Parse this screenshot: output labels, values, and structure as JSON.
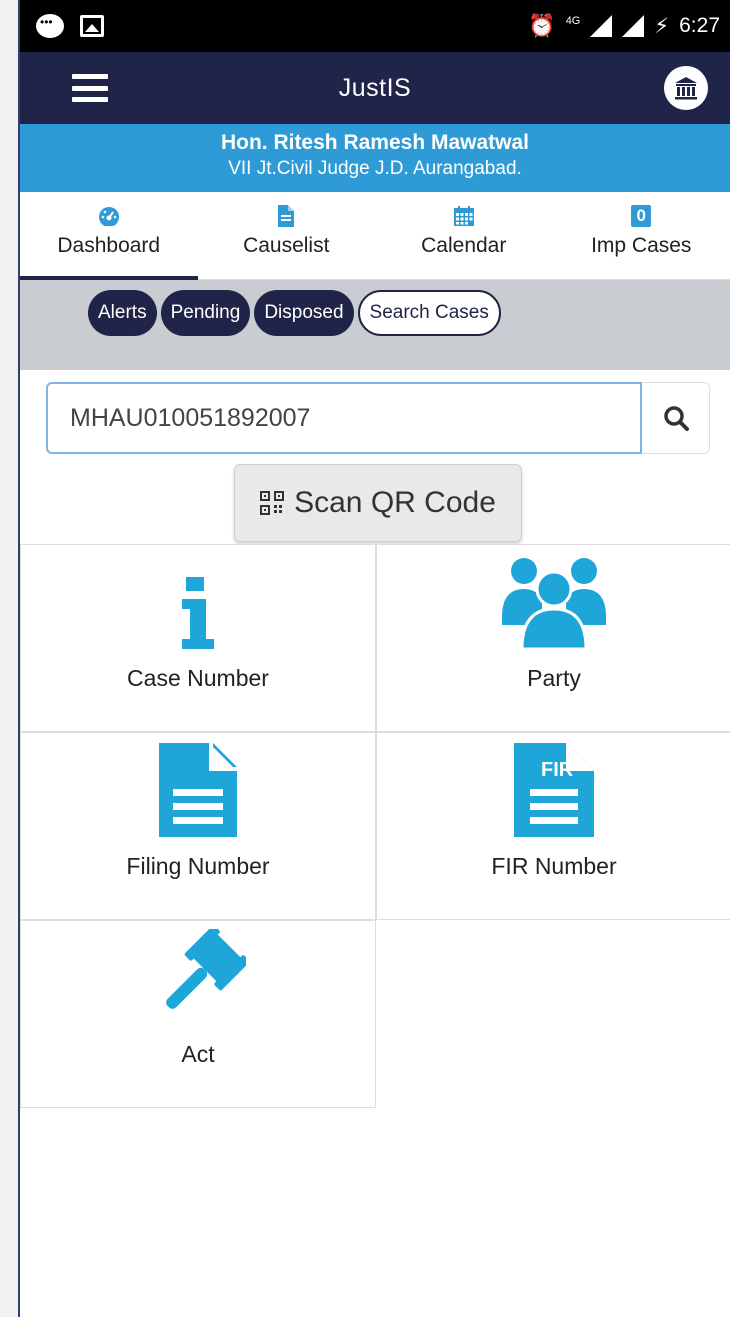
{
  "status_bar": {
    "time": "6:27",
    "network": "4G"
  },
  "app_bar": {
    "title": "JustIS"
  },
  "banner": {
    "judge_name": "Hon. Ritesh Ramesh Mawatwal",
    "designation": "VII Jt.Civil Judge J.D. Aurangabad."
  },
  "tabs": [
    {
      "label": "Dashboard",
      "icon": "dashboard-icon"
    },
    {
      "label": "Causelist",
      "icon": "document-icon"
    },
    {
      "label": "Calendar",
      "icon": "calendar-icon"
    },
    {
      "label": "Imp Cases",
      "badge": "0"
    }
  ],
  "filters": [
    "Alerts",
    "Pending",
    "Disposed",
    "Search Cases"
  ],
  "search": {
    "value": "MHAU010051892007"
  },
  "qr_button": {
    "label": "Scan QR Code"
  },
  "options": [
    {
      "label": "Case Number",
      "icon": "info-icon"
    },
    {
      "label": "Party",
      "icon": "people-icon"
    },
    {
      "label": "Filing Number",
      "icon": "file-icon"
    },
    {
      "label": "FIR Number",
      "icon": "fir-file-icon",
      "icon_text": "FIR"
    },
    {
      "label": "Act",
      "icon": "gavel-icon"
    }
  ],
  "colors": {
    "navy": "#1f2448",
    "accent_blue": "#2e9bd6",
    "filter_bg": "#c9ccd0"
  }
}
